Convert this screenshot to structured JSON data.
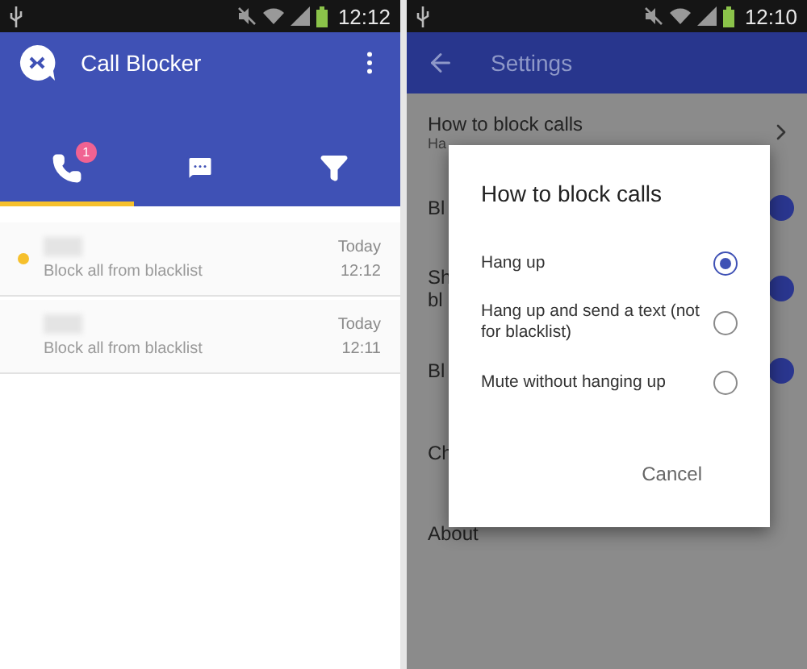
{
  "screens": [
    {
      "kind": "call-log",
      "status_bar": {
        "time": "12:12"
      },
      "app_bar": {
        "title": "Call Blocker"
      },
      "tabs": [
        {
          "kind": "calls",
          "badge": "1",
          "selected": true
        },
        {
          "kind": "messages",
          "selected": false
        },
        {
          "kind": "filters",
          "selected": false
        }
      ],
      "entries": [
        {
          "unread": true,
          "description": "Block all from blacklist",
          "date": "Today",
          "time": "12:12"
        },
        {
          "unread": false,
          "description": "Block all from blacklist",
          "date": "Today",
          "time": "12:11"
        }
      ]
    },
    {
      "kind": "settings",
      "status_bar": {
        "time": "12:10"
      },
      "toolbar": {
        "title": "Settings"
      },
      "settings": [
        {
          "kind": "link",
          "lines": [
            "How to block calls"
          ],
          "subtitle": "Ha"
        },
        {
          "kind": "toggle",
          "lines": [
            "Bl"
          ],
          "on": true
        },
        {
          "kind": "toggle",
          "lines": [
            "Sh",
            "bl"
          ],
          "on": true
        },
        {
          "kind": "toggle",
          "lines": [
            "Bl"
          ],
          "on": true
        },
        {
          "kind": "plain",
          "lines": [
            "Ch"
          ]
        },
        {
          "kind": "plain",
          "lines": [
            "About"
          ]
        }
      ],
      "dialog": {
        "title": "How to block calls",
        "options": [
          {
            "label": "Hang up",
            "selected": true
          },
          {
            "label": "Hang up and send a text (not for blacklist)",
            "selected": false
          },
          {
            "label": "Mute without hanging up",
            "selected": false
          }
        ],
        "buttons": [
          "Cancel"
        ]
      }
    }
  ]
}
